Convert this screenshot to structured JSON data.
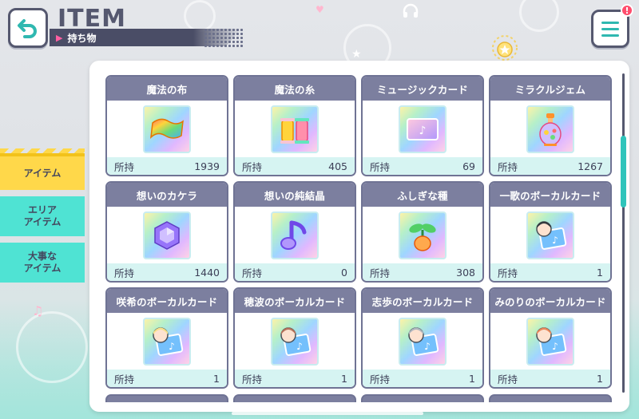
{
  "header": {
    "title": "ITEM",
    "subtitle": "持ち物",
    "back_icon": "back-arrow-icon",
    "menu_icon": "hamburger-menu-icon",
    "notification_badge": "!"
  },
  "sidebar": {
    "tabs": [
      {
        "label": "アイテム",
        "active": true
      },
      {
        "label": "エリア\nアイテム",
        "active": false
      },
      {
        "label": "大事な\nアイテム",
        "active": false
      }
    ]
  },
  "items": [
    {
      "name": "魔法の布",
      "owned_label": "所持",
      "count": "1939",
      "icon": "magic-cloth-icon"
    },
    {
      "name": "魔法の糸",
      "owned_label": "所持",
      "count": "405",
      "icon": "thread-spools-icon"
    },
    {
      "name": "ミュージックカード",
      "owned_label": "所持",
      "count": "69",
      "icon": "music-card-icon"
    },
    {
      "name": "ミラクルジェム",
      "owned_label": "所持",
      "count": "1267",
      "icon": "miracle-gem-bottle-icon"
    },
    {
      "name": "想いのカケラ",
      "owned_label": "所持",
      "count": "1440",
      "icon": "crystal-shard-icon"
    },
    {
      "name": "想いの純結晶",
      "owned_label": "所持",
      "count": "0",
      "icon": "music-note-crystal-icon"
    },
    {
      "name": "ふしぎな種",
      "owned_label": "所持",
      "count": "308",
      "icon": "sprout-seed-icon"
    },
    {
      "name": "一歌のボーカルカード",
      "owned_label": "所持",
      "count": "1",
      "icon": "vocal-card-ichika-icon"
    },
    {
      "name": "咲希のボーカルカード",
      "owned_label": "所持",
      "count": "1",
      "icon": "vocal-card-saki-icon"
    },
    {
      "name": "穂波のボーカルカード",
      "owned_label": "所持",
      "count": "1",
      "icon": "vocal-card-honami-icon"
    },
    {
      "name": "志歩のボーカルカード",
      "owned_label": "所持",
      "count": "1",
      "icon": "vocal-card-shiho-icon"
    },
    {
      "name": "みのりのボーカルカード",
      "owned_label": "所持",
      "count": "1",
      "icon": "vocal-card-minori-icon"
    }
  ],
  "colors": {
    "card_header": "#7c7f9f",
    "card_footer": "#d6f4f2",
    "active_tab": "#ffd84a",
    "inactive_tab": "#4fe3d3",
    "accent": "#2fc4bb"
  }
}
